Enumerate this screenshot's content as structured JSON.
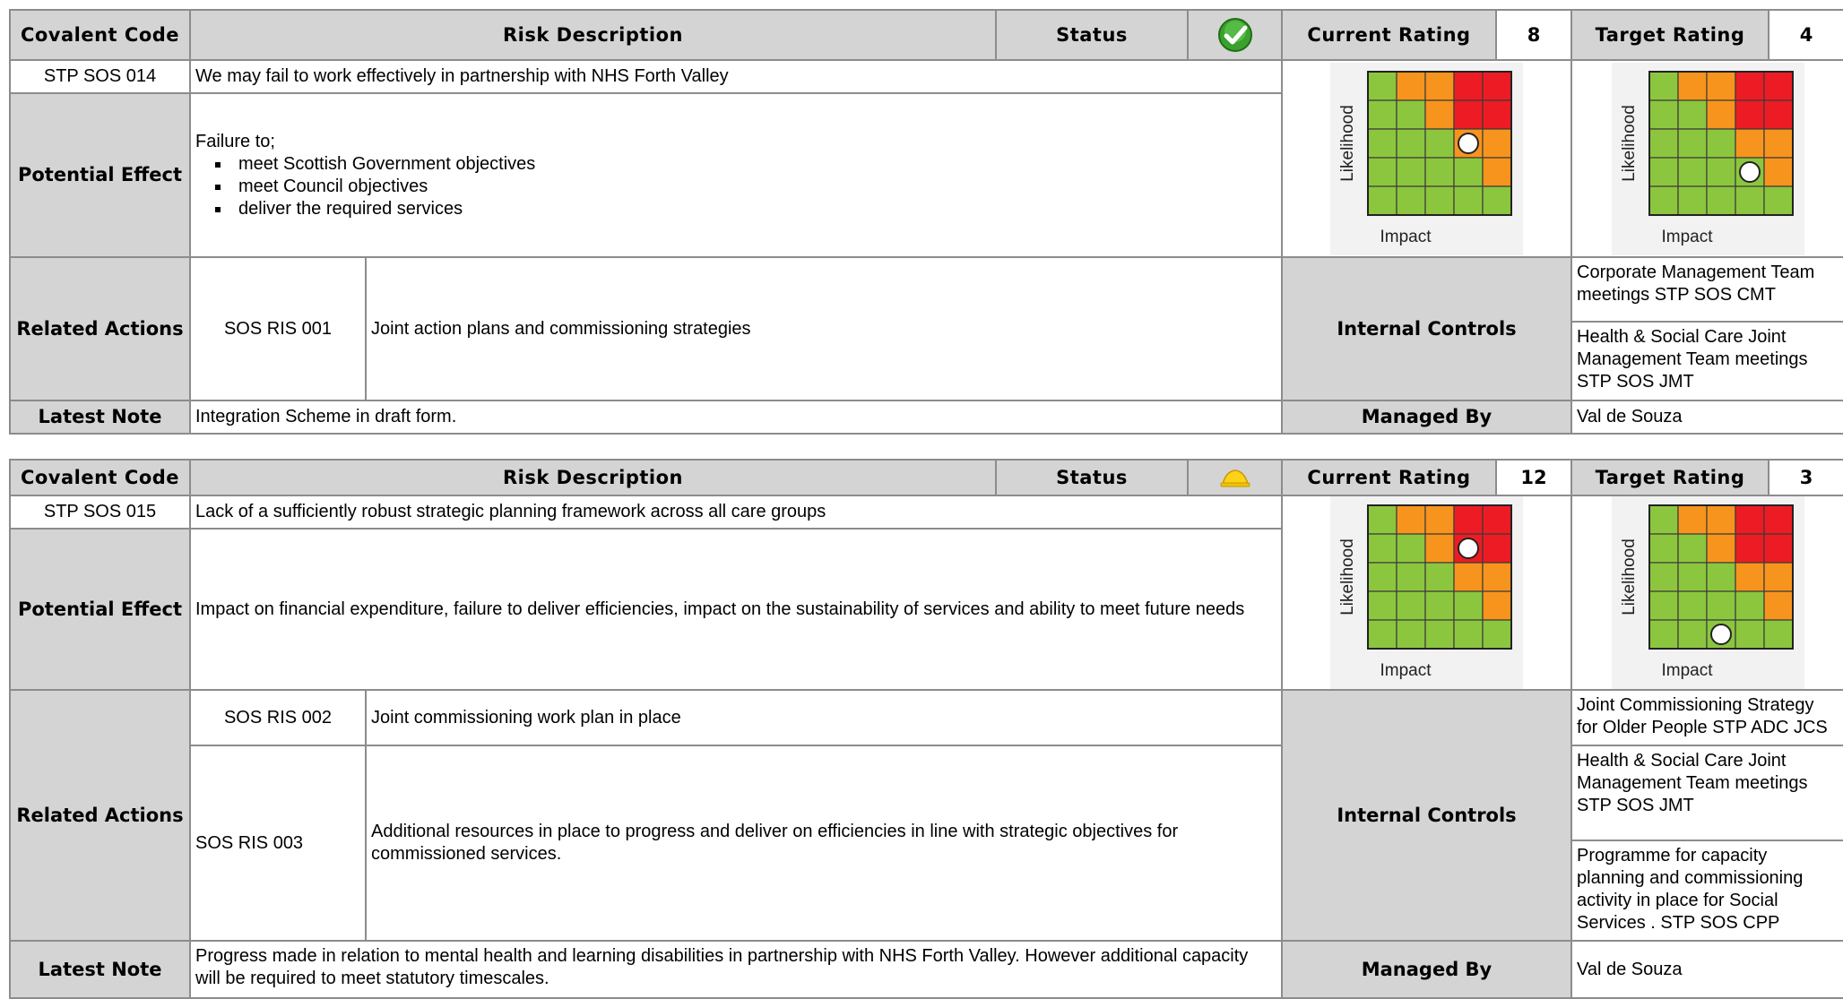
{
  "headers": {
    "code": "Covalent Code",
    "risk": "Risk Description",
    "status": "Status",
    "current": "Current Rating",
    "target": "Target Rating",
    "potential_effect": "Potential Effect",
    "related_actions": "Related Actions",
    "internal_controls": "Internal Controls",
    "latest_note": "Latest Note",
    "managed_by": "Managed By"
  },
  "matrix_labels": {
    "likelihood": "Likelihood",
    "impact": "Impact"
  },
  "colors": {
    "green": "#8cc63e",
    "orange": "#f7941d",
    "red": "#ed1c24",
    "header_bg": "#d4d4d4",
    "border": "#8c8c8c"
  },
  "risks": [
    {
      "code": "STP SOS 014",
      "description": "We may fail to work effectively in partnership with NHS Forth Valley",
      "status_icon": "green-tick-icon",
      "current_rating": "8",
      "target_rating": "4",
      "effect_intro": "Failure to;",
      "effect_bullets": [
        "meet Scottish Government objectives",
        "meet Council objectives",
        "deliver the required services"
      ],
      "actions": [
        {
          "code": "SOS RIS 001",
          "text": "Joint action plans and commissioning strategies"
        }
      ],
      "controls": [
        "Corporate Management Team meetings     STP SOS CMT",
        "Health & Social Care Joint Management Team meetings STP SOS JMT"
      ],
      "note": "Integration Scheme in draft form.",
      "managed_by": "Val de Souza",
      "current_marker": {
        "impact": 4,
        "likelihood": 3
      },
      "target_marker": {
        "impact": 4,
        "likelihood": 2
      }
    },
    {
      "code": "STP SOS 015",
      "description": "Lack of a sufficiently robust strategic planning framework across all care groups",
      "status_icon": "yellow-warning-icon",
      "current_rating": "12",
      "target_rating": "3",
      "effect_text": "Impact on financial expenditure, failure to deliver efficiencies, impact on the sustainability of services and ability to meet future needs",
      "actions": [
        {
          "code": "SOS RIS 002",
          "text": "Joint commissioning work plan in place"
        },
        {
          "code": "SOS RIS 003",
          "text": "Additional resources in place to progress and deliver on efficiencies in line with strategic objectives for commissioned services."
        }
      ],
      "controls": [
        "Joint Commissioning Strategy for Older People STP ADC JCS",
        "Health & Social Care Joint Management Team meetings STP SOS JMT",
        "Programme for capacity planning and commissioning activity in place for Social Services . STP SOS CPP"
      ],
      "note": "Progress made in relation to mental health and learning disabilities in partnership with NHS Forth Valley.  However additional capacity will be required to meet statutory timescales.",
      "managed_by": "Val de Souza",
      "current_marker": {
        "impact": 4,
        "likelihood": 4
      },
      "target_marker": {
        "impact": 3,
        "likelihood": 1
      }
    }
  ]
}
